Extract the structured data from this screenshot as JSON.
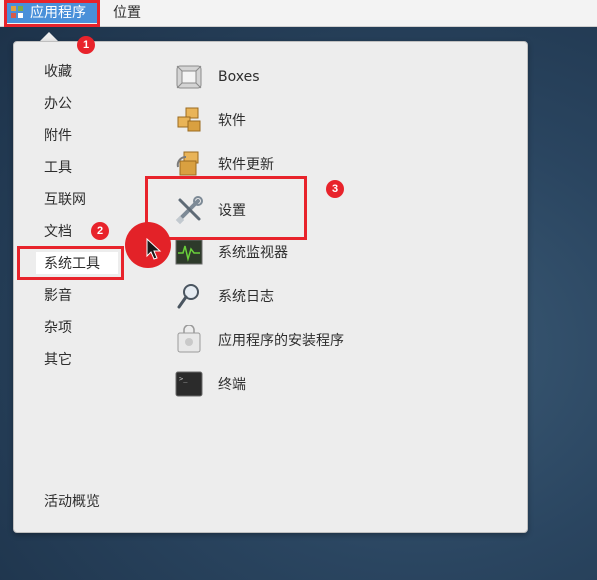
{
  "topbar": {
    "applications_label": "应用程序",
    "places_label": "位置"
  },
  "categories": [
    {
      "label": "收藏"
    },
    {
      "label": "办公"
    },
    {
      "label": "附件"
    },
    {
      "label": "工具"
    },
    {
      "label": "互联网"
    },
    {
      "label": "文档"
    },
    {
      "label": "系统工具",
      "selected": true
    },
    {
      "label": "影音"
    },
    {
      "label": "杂项"
    },
    {
      "label": "其它"
    }
  ],
  "activities_label": "活动概览",
  "apps": [
    {
      "label": "Boxes",
      "icon": "boxes-icon"
    },
    {
      "label": "软件",
      "icon": "software-icon"
    },
    {
      "label": "软件更新",
      "icon": "software-update-icon"
    },
    {
      "label": "设置",
      "icon": "settings-tools-icon"
    },
    {
      "label": "系统监视器",
      "icon": "system-monitor-icon"
    },
    {
      "label": "系统日志",
      "icon": "system-log-icon"
    },
    {
      "label": "应用程序的安装程序",
      "icon": "app-installer-icon"
    },
    {
      "label": "终端",
      "icon": "terminal-icon"
    }
  ],
  "annotations": {
    "badge1": "1",
    "badge2": "2",
    "badge3": "3",
    "color": "#e8232b"
  }
}
